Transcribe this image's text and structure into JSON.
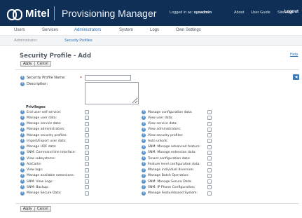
{
  "header": {
    "logo_text": "Mitel",
    "app_title": "Provisioning Manager",
    "logged_in_prefix": "Logged in as:",
    "username": "sysadmin",
    "links": [
      "About",
      "User Guide",
      "Site Map"
    ],
    "logout": "Logout"
  },
  "main_nav": {
    "items": [
      "Users",
      "Services",
      "Administrators",
      "System",
      "Logs",
      "Own Settings"
    ],
    "active": "Administrators"
  },
  "sub_nav": {
    "items": [
      "Administrator",
      "Security Profiles"
    ],
    "active": "Security Profiles"
  },
  "page": {
    "title": "Security Profile - Add",
    "help": "Help",
    "apply": "Apply",
    "cancel": "Cancel"
  },
  "form": {
    "profile_name_label": "Security Profile Name:",
    "profile_name_value": "",
    "required_marker": "*",
    "description_label": "Description:",
    "description_value": ""
  },
  "privileges": {
    "heading": "Privileges",
    "left": [
      {
        "label": "End user self service:",
        "checked": false
      },
      {
        "label": "Manage user data:",
        "checked": false
      },
      {
        "label": "Manage service data:",
        "checked": false
      },
      {
        "label": "Manage administrators:",
        "checked": false
      },
      {
        "label": "Manage security profiles:",
        "checked": false
      },
      {
        "label": "Import/Export user data:",
        "checked": false
      },
      {
        "label": "Manage UDF data:",
        "checked": false
      },
      {
        "label": "SNM: Command line interface:",
        "checked": false
      },
      {
        "label": "View subsystems:",
        "checked": false
      },
      {
        "label": "AlaCarte:",
        "checked": false
      },
      {
        "label": "View logs:",
        "checked": false
      },
      {
        "label": "Manage available extensions:",
        "checked": false
      },
      {
        "label": "SNM: View Logs:",
        "checked": false
      },
      {
        "label": "SNM: Backup:",
        "checked": false
      },
      {
        "label": "Manage Secure Data:",
        "checked": false
      }
    ],
    "right": [
      {
        "label": "Manage configuration data:",
        "checked": false
      },
      {
        "label": "View user data:",
        "checked": false
      },
      {
        "label": "View service data:",
        "checked": false
      },
      {
        "label": "View administrators:",
        "checked": false
      },
      {
        "label": "View security profiles:",
        "checked": false
      },
      {
        "label": "Auto unlock:",
        "checked": false
      },
      {
        "label": "SNM: Manage advanced feature:",
        "checked": false
      },
      {
        "label": "SNM: Manage extension data:",
        "checked": false
      },
      {
        "label": "Tenant configuration data:",
        "checked": false
      },
      {
        "label": "Feature level configuration data:",
        "checked": false
      },
      {
        "label": "Manage individual diversion:",
        "checked": false
      },
      {
        "label": "Manage Batch Operation:",
        "checked": false
      },
      {
        "label": "SNM: Manage Secure Data:",
        "checked": false
      },
      {
        "label": "SNM: IP Phone Configuration:",
        "checked": false
      },
      {
        "label": "Manage Featurebased System:",
        "checked": false
      }
    ]
  },
  "colors": {
    "header_bg": "#0f2f56",
    "link_blue": "#2d6fb1",
    "required_red": "#d01f1f",
    "help_icon": "#5d93c9"
  }
}
